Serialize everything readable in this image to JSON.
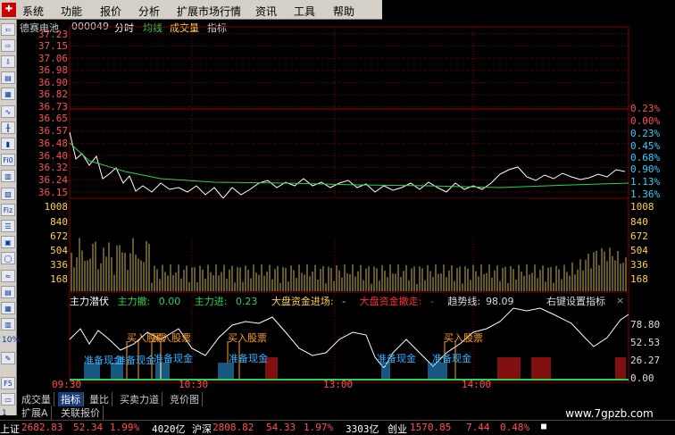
{
  "menubar": {
    "items": [
      "系统",
      "功能",
      "报价",
      "分析",
      "扩展市场行情",
      "资讯",
      "工具",
      "帮助"
    ]
  },
  "toolbar": {
    "numbers": [
      "1",
      "5"
    ],
    "pct_label": "10%"
  },
  "chart": {
    "stock_name": "德赛电池",
    "code": "000049",
    "mode": "分时",
    "avg_label": "均线",
    "vol_label": "成交量",
    "ind_label": "指标",
    "price_ticks": [
      "37.23",
      "37.15",
      "37.06",
      "36.98",
      "36.90",
      "36.82",
      "36.73",
      "36.65",
      "36.57",
      "36.48",
      "36.40",
      "36.32",
      "36.24",
      "36.15"
    ],
    "pct_ticks": [
      {
        "t": "0.23%",
        "c": "r"
      },
      {
        "t": "0.00%",
        "c": "r"
      },
      {
        "t": "0.23%",
        "c": "g"
      },
      {
        "t": "0.45%",
        "c": "g"
      },
      {
        "t": "0.68%",
        "c": "g"
      },
      {
        "t": "0.90%",
        "c": "g"
      },
      {
        "t": "1.13%",
        "c": "g"
      },
      {
        "t": "1.36%",
        "c": "g"
      }
    ],
    "vol_ticks": [
      "1008",
      "840",
      "672",
      "504",
      "336",
      "168"
    ],
    "x_ticks": [
      "09:30",
      "10:30",
      "13:00",
      "14:00"
    ]
  },
  "indicator": {
    "name": "主力潜伏",
    "main_sell_label": "主力撤:",
    "main_sell": "0.00",
    "main_buy_label": "主力进:",
    "main_buy": "0.23",
    "market_in_label": "大盘资金进场:",
    "market_in": "-",
    "market_out_label": "大盘资金撤走:",
    "market_out": "-",
    "trend_label": "趋势线:",
    "trend": "98.09",
    "right_menu": "右键设置指标",
    "close": "×",
    "y_ticks": [
      "78.80",
      "52.53",
      "26.27",
      "0.00"
    ],
    "buy_label": "买入股票",
    "prep_label": "准备现金"
  },
  "bottom_tabs": [
    "成交量",
    "指标",
    "量比",
    "买卖力道",
    "竞价图"
  ],
  "tabs_row2": [
    "扩展A",
    "关联报价"
  ],
  "ticker": {
    "sh_label": "上证",
    "sh_val": "2682.83",
    "sh_chg": "52.34",
    "sh_pct": "1.99%",
    "sh_amt": "4020亿",
    "hs_label": "沪深",
    "hs_val": "2808.82",
    "hs_chg": "54.33",
    "hs_pct": "1.97%",
    "hs_amt": "3303亿",
    "cy_label": "创业",
    "cy_val": "1570.85",
    "cy_chg": "7.44",
    "cy_pct": "0.48%"
  },
  "watermark": "www.7gpzb.com",
  "colors": {
    "up": "#ff5050",
    "down": "#30d0ff",
    "price_line": "#ffffff",
    "avg_line": "#30d050",
    "volume": "#c8b450",
    "grid": "#800000"
  }
}
